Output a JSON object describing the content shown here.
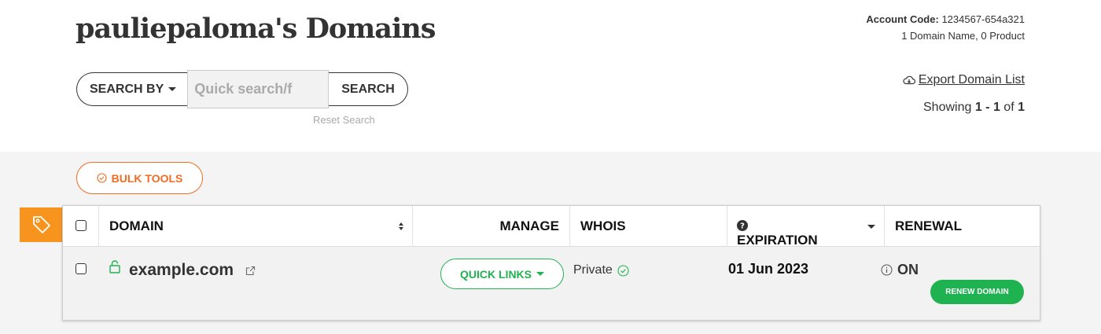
{
  "page": {
    "title": "pauliepaloma's Domains"
  },
  "account": {
    "code_label": "Account Code:",
    "code_value": "1234567-654a321",
    "summary": "1 Domain Name, 0 Product",
    "export_label": "Export Domain List",
    "showing_prefix": "Showing",
    "showing_range": "1 - 1",
    "showing_of": "of",
    "showing_total": "1"
  },
  "search": {
    "by_label": "SEARCH BY",
    "placeholder": "Quick search/f",
    "button_label": "SEARCH",
    "reset_label": "Reset Search"
  },
  "bulk_tools": {
    "label": "BULK TOOLS"
  },
  "table": {
    "columns": {
      "domain": "DOMAIN",
      "manage": "MANAGE",
      "whois": "WHOIS",
      "expiration": "EXPIRATION",
      "renewal": "RENEWAL"
    },
    "rows": [
      {
        "domain": "example.com",
        "manage_label": "QUICK LINKS",
        "whois": "Private",
        "expiration": "01 Jun 2023",
        "renewal": "ON",
        "renew_button": "RENEW DOMAIN"
      }
    ]
  },
  "colors": {
    "accent_orange": "#f26b21",
    "badge_orange": "#f7941d",
    "green": "#1fb250"
  },
  "icons": [
    "chevron-down-icon",
    "cloud-download-icon",
    "check-circle-icon",
    "tag-icon",
    "sort-icon",
    "help-icon",
    "lock-icon",
    "external-link-icon",
    "info-icon"
  ]
}
